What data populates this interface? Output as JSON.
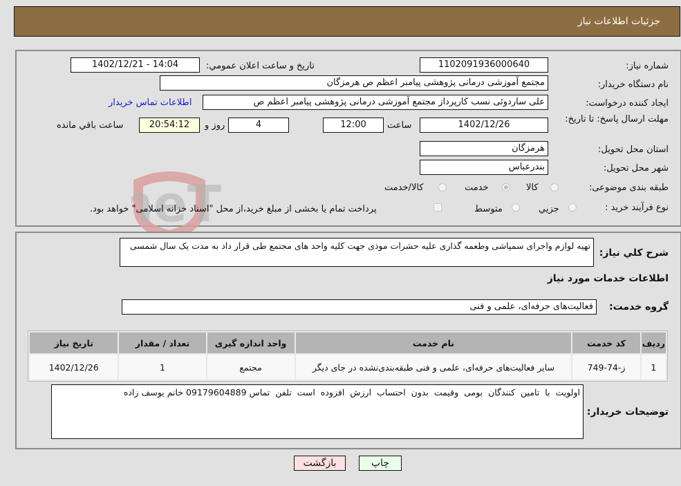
{
  "header": {
    "title": "جزئیات اطلاعات نیاز"
  },
  "form": {
    "need_number": {
      "label": "شماره نیاز:",
      "value": "1102091936000640"
    },
    "announce_datetime": {
      "label": "تاریخ و ساعت اعلان عمومي:",
      "value": "1402/12/21 - 14:04"
    },
    "buyer_org": {
      "label": "نام دستگاه خریدار:",
      "value": "مجتمع آموزشی درمانی پژوهشی پیامبر اعظم ص  هرمزگان"
    },
    "requester": {
      "label": "ایجاد کننده درخواست:",
      "value": "علی ساردوئی نسب کارپرداز مجتمع آموزشی درمانی پژوهشی پیامبر اعظم ص"
    },
    "contact_link": "اطلاعات تماس خریدار",
    "deadline": {
      "label": "مهلت ارسال پاسخ: تا تاریخ:",
      "date": "1402/12/26",
      "time_label": "ساعت",
      "time": "12:00",
      "days": "4",
      "days_label": "روز و",
      "remaining": "20:54:12",
      "remaining_label": "ساعت باقي مانده"
    },
    "province": {
      "label": "استان محل تحویل:",
      "value": "هرمزگان"
    },
    "city": {
      "label": "شهر محل تحویل:",
      "value": "بندرعباس"
    },
    "category": {
      "label": "طبقه بندی موضوعی:",
      "options": [
        "کالا",
        "خدمت",
        "کالا/خدمت"
      ],
      "selected": "خدمت"
    },
    "purchase_type": {
      "label": "نوع فرآیند خرید :",
      "options": [
        "جزيي",
        "متوسط"
      ],
      "treasury_note": "پرداخت تمام یا بخشی از مبلغ خرید،از محل \"اسناد خزانه اسلامی\" خواهد بود."
    }
  },
  "description": {
    "label": "شرح کلي نیاز:",
    "value": "تهیه لوازم واجرای سمپاشی وطعمه گذاری علیه حشرات موذی جهت کلیه واحد های مجتمع طی قرار داد به مدت یک سال شمسی"
  },
  "services_section": {
    "title": "اطلاعات خدمات مورد نیاز"
  },
  "service_group": {
    "label": "گروه خدمت:",
    "value": "فعالیت‌های حرفه‌ای، علمی و فنی"
  },
  "table": {
    "headers": [
      "ردیف",
      "کد خدمت",
      "نام خدمت",
      "واحد اندازه گیری",
      "تعداد / مقدار",
      "تاریخ نیاز"
    ],
    "rows": [
      [
        "1",
        "ز-74-749",
        "سایر فعالیت‌های حرفه‌ای، علمی و فنی طبقه‌بندی‌نشده در جای دیگر",
        "مجتمع",
        "1",
        "1402/12/26"
      ]
    ]
  },
  "buyer_notes": {
    "label": "توضیحات خریدار:",
    "value": "اولویت  با  تامین  کنندگان  بومی  وقیمت  بدون  احتساب  ارزش  افزوده  است  تلفن  تماس 09179604889 خانم یوسف زاده"
  },
  "buttons": {
    "print": "چاپ",
    "back": "بازگشت"
  },
  "watermark": {
    "text": "AriaTender.neT"
  }
}
